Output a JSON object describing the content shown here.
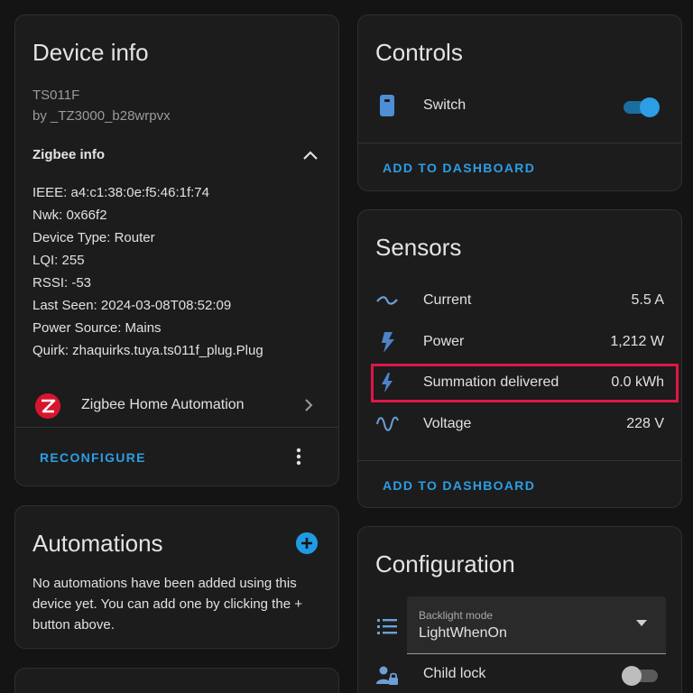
{
  "device_info": {
    "title": "Device info",
    "model": "TS011F",
    "manufacturer": "by _TZ3000_b28wrpvx",
    "zigbee_header": "Zigbee info",
    "lines": [
      "IEEE: a4:c1:38:0e:f5:46:1f:74",
      "Nwk: 0x66f2",
      "Device Type: Router",
      "LQI: 255",
      "RSSI: -53",
      "Last Seen: 2024-03-08T08:52:09",
      "Power Source: Mains",
      "Quirk: zhaquirks.tuya.ts011f_plug.Plug"
    ],
    "integration_label": "Zigbee Home Automation",
    "reconfigure_label": "RECONFIGURE"
  },
  "automations": {
    "title": "Automations",
    "empty_text": "No automations have been added using this device yet. You can add one by clicking the + button above."
  },
  "controls": {
    "title": "Controls",
    "items": [
      {
        "label": "Switch",
        "icon": "outlet-icon",
        "state": "on"
      }
    ],
    "add_label": "ADD TO DASHBOARD"
  },
  "sensors": {
    "title": "Sensors",
    "items": [
      {
        "label": "Current",
        "value": "5.5 A",
        "icon": "current-ac-icon"
      },
      {
        "label": "Power",
        "value": "1,212 W",
        "icon": "flash-icon"
      },
      {
        "label": "Summation delivered",
        "value": "0.0 kWh",
        "icon": "flash-icon",
        "highlighted": true
      },
      {
        "label": "Voltage",
        "value": "228 V",
        "icon": "sine-wave-icon"
      }
    ],
    "add_label": "ADD TO DASHBOARD"
  },
  "configuration": {
    "title": "Configuration",
    "backlight": {
      "label": "Backlight mode",
      "value": "LightWhenOn",
      "icon": "list-icon"
    },
    "child_lock": {
      "label": "Child lock",
      "icon": "account-lock-icon",
      "state": "off"
    }
  },
  "colors": {
    "accent": "#2c9ee5",
    "highlight": "#e01546",
    "zigbee_logo": "#d6162e",
    "card": "#1c1c1c",
    "background": "#141414"
  }
}
